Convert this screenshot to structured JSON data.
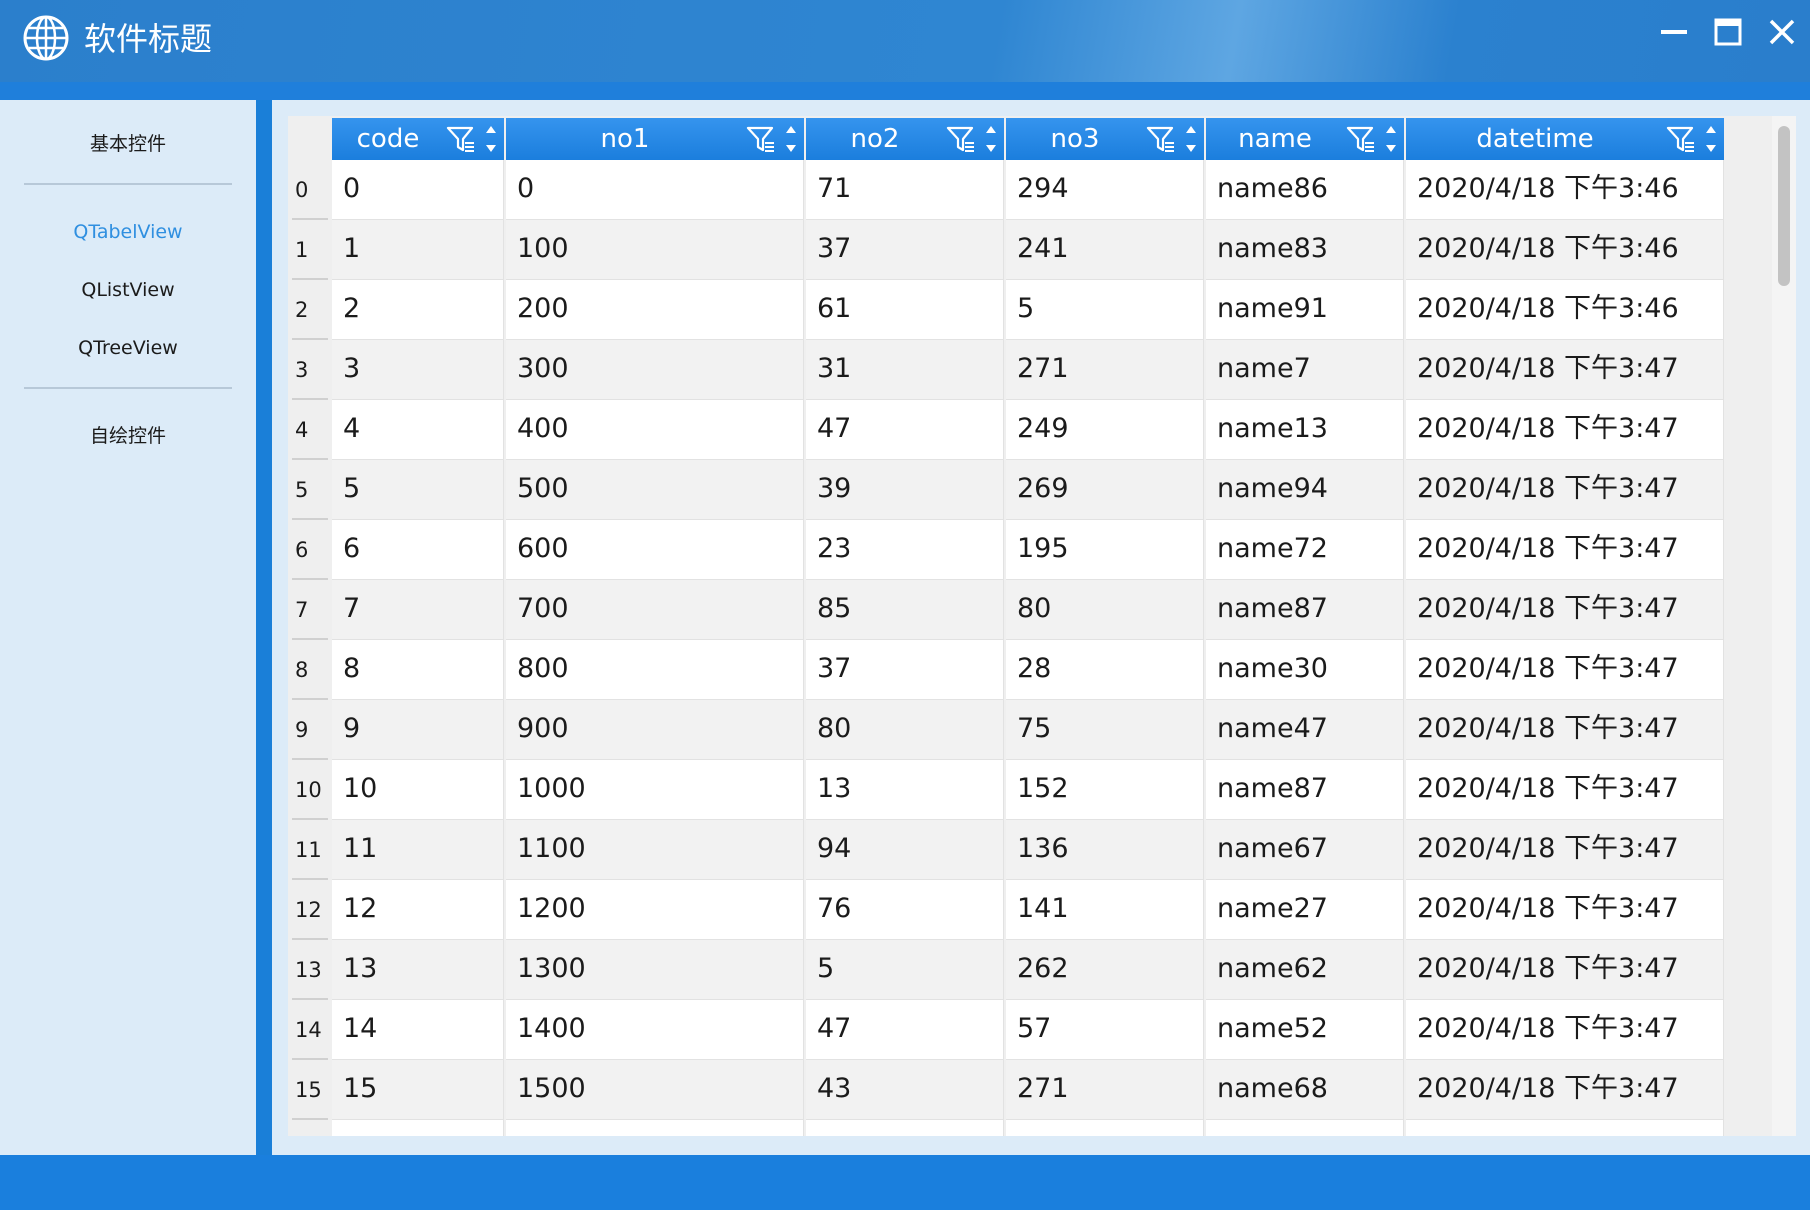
{
  "window": {
    "title": "软件标题",
    "logo_icon": "globe-icon",
    "controls": [
      "minimize-icon",
      "maximize-icon",
      "close-icon"
    ]
  },
  "colors": {
    "titlebar": "#2b7fcc",
    "accent": "#1a7fdd",
    "sidebar_bg": "#dcebf8",
    "active_nav": "#2f8fe0",
    "header_bg": "#1b7edd"
  },
  "sidebar": {
    "items": [
      {
        "label": "基本控件",
        "active": false
      },
      {
        "label": "QTabelView",
        "active": true
      },
      {
        "label": "QListView",
        "active": false
      },
      {
        "label": "QTreeView",
        "active": false
      },
      {
        "label": "自绘控件",
        "active": false
      }
    ]
  },
  "table": {
    "columns": [
      "code",
      "no1",
      "no2",
      "no3",
      "name",
      "datetime"
    ],
    "header_icons": [
      "filter-icon",
      "sort-arrows-icon"
    ],
    "rows": [
      {
        "index": "0",
        "cells": [
          "0",
          "0",
          "71",
          "294",
          "name86",
          "2020/4/18 下午3:46"
        ]
      },
      {
        "index": "1",
        "cells": [
          "1",
          "100",
          "37",
          "241",
          "name83",
          "2020/4/18 下午3:46"
        ]
      },
      {
        "index": "2",
        "cells": [
          "2",
          "200",
          "61",
          "5",
          "name91",
          "2020/4/18 下午3:46"
        ]
      },
      {
        "index": "3",
        "cells": [
          "3",
          "300",
          "31",
          "271",
          "name7",
          "2020/4/18 下午3:47"
        ]
      },
      {
        "index": "4",
        "cells": [
          "4",
          "400",
          "47",
          "249",
          "name13",
          "2020/4/18 下午3:47"
        ]
      },
      {
        "index": "5",
        "cells": [
          "5",
          "500",
          "39",
          "269",
          "name94",
          "2020/4/18 下午3:47"
        ]
      },
      {
        "index": "6",
        "cells": [
          "6",
          "600",
          "23",
          "195",
          "name72",
          "2020/4/18 下午3:47"
        ]
      },
      {
        "index": "7",
        "cells": [
          "7",
          "700",
          "85",
          "80",
          "name87",
          "2020/4/18 下午3:47"
        ]
      },
      {
        "index": "8",
        "cells": [
          "8",
          "800",
          "37",
          "28",
          "name30",
          "2020/4/18 下午3:47"
        ]
      },
      {
        "index": "9",
        "cells": [
          "9",
          "900",
          "80",
          "75",
          "name47",
          "2020/4/18 下午3:47"
        ]
      },
      {
        "index": "10",
        "cells": [
          "10",
          "1000",
          "13",
          "152",
          "name87",
          "2020/4/18 下午3:47"
        ]
      },
      {
        "index": "11",
        "cells": [
          "11",
          "1100",
          "94",
          "136",
          "name67",
          "2020/4/18 下午3:47"
        ]
      },
      {
        "index": "12",
        "cells": [
          "12",
          "1200",
          "76",
          "141",
          "name27",
          "2020/4/18 下午3:47"
        ]
      },
      {
        "index": "13",
        "cells": [
          "13",
          "1300",
          "5",
          "262",
          "name62",
          "2020/4/18 下午3:47"
        ]
      },
      {
        "index": "14",
        "cells": [
          "14",
          "1400",
          "47",
          "57",
          "name52",
          "2020/4/18 下午3:47"
        ]
      },
      {
        "index": "15",
        "cells": [
          "15",
          "1500",
          "43",
          "271",
          "name68",
          "2020/4/18 下午3:47"
        ]
      }
    ]
  }
}
